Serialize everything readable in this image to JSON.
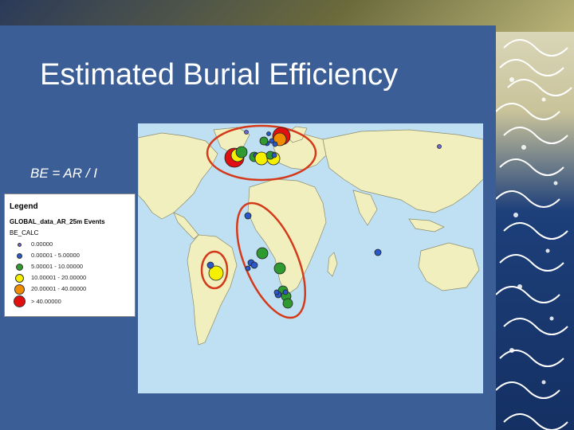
{
  "slide": {
    "title": "Estimated Burial Efficiency",
    "formula": "BE = AR / I"
  },
  "legend": {
    "title": "Legend",
    "layer": "GLOBAL_data_AR_25m Events",
    "field": "BE_CALC",
    "items": [
      {
        "label": "0.00000",
        "color": "#6b6bd6"
      },
      {
        "label": "0.00001 - 5.00000",
        "color": "#2a58c8"
      },
      {
        "label": "5.00001 - 10.00000",
        "color": "#2f9a2f"
      },
      {
        "label": "10.00001 - 20.00000",
        "color": "#f5f000"
      },
      {
        "label": "20.00001 - 40.00000",
        "color": "#f08c00"
      },
      {
        "label": "> 40.00000",
        "color": "#e01010"
      }
    ]
  },
  "colors": {
    "ocean": "#bfe0f2",
    "land": "#f2efbf",
    "highlight_ellipse": "#d43a1a",
    "slide_background": "#3b5e96"
  },
  "icons": {
    "decoration": "wave-decoration"
  }
}
